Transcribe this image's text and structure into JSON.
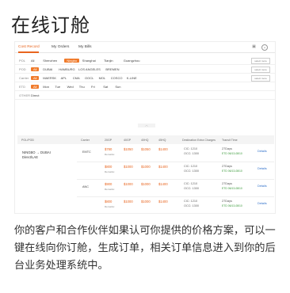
{
  "page": {
    "title": "在线订舱",
    "description": "你的客户和合作伙伴如果认可你提供的价格方案，可以一键在线向你订舱，生成订单，相关订单信息进入到你的后台业务处理系统中。"
  },
  "app": {
    "tabs": [
      "Cost Record",
      "My Orders",
      "My Bills"
    ],
    "active_tab": 0,
    "accent_color": "#e8651f",
    "header_icons": [
      "chat-icon",
      "user-icon"
    ]
  },
  "filters": [
    {
      "label": "POL",
      "options": [
        "All",
        "Shenzhen",
        "Ningbo",
        "Shanghai",
        "Tianjin",
        "Guangzhou"
      ],
      "selected": 2,
      "button": "select more"
    },
    {
      "label": "POD",
      "options": [
        "All",
        "DUBAI",
        "HAMBURG",
        "LOS ANGELES",
        "BREMEN"
      ],
      "selected": 0,
      "button": "select more"
    },
    {
      "label": "Carrier",
      "options": [
        "All",
        "MAERSK",
        "APL",
        "CMA",
        "OOCL",
        "MOL",
        "COSCO",
        "K-LINE"
      ],
      "selected": 0,
      "button": "select more"
    },
    {
      "label": "ETD",
      "options": [
        "All",
        "Mon",
        "Tue",
        "Wed",
        "Thu",
        "Fri",
        "Sat",
        "Sun"
      ],
      "selected": 0,
      "button": ""
    },
    {
      "label": "OTHER",
      "options": [
        "Direct"
      ],
      "selected": -1,
      "button": ""
    }
  ],
  "table": {
    "headers": [
      "POL/POD",
      "Carrier",
      "20GP",
      "40GP",
      "40HQ",
      "45HQ",
      "Destination Extra Charges",
      "Transit Time",
      ""
    ],
    "route": [
      "NINGBO → DUBAI",
      "Direct/LAE"
    ],
    "groups": [
      {
        "carrier": "EMTC",
        "rows": [
          {
            "p20": "$780",
            "p40": "$1050",
            "p40hq": "$1050",
            "p45": "$1400",
            "note": "Remarks:",
            "charges": [
              "CIC: 1210",
              "OCC: 1300"
            ],
            "transit": [
              "27Days",
              "ETD 06/13-08/10"
            ],
            "action": "Details"
          },
          {
            "p20": "$800",
            "p40": "$1000",
            "p40hq": "$1000",
            "p45": "$1400",
            "note": "Remarks:",
            "charges": [
              "CIC: 1210",
              "OCC: 1300"
            ],
            "transit": [
              "27Days",
              "ETD 06/13-08/10"
            ],
            "action": "Details"
          }
        ]
      },
      {
        "carrier": "ANC",
        "rows": [
          {
            "p20": "$900",
            "p40": "$1000",
            "p40hq": "$1000",
            "p45": "$1400",
            "note": "Remarks:",
            "charges": [
              "CIC: 1210",
              "OCC: 1300"
            ],
            "transit": [
              "27Days",
              "ETD 06/13-08/10"
            ],
            "action": "Details"
          },
          {
            "p20": "$800",
            "p40": "$1000",
            "p40hq": "$1000",
            "p45": "$1400",
            "note": "Remarks:",
            "charges": [
              "CIC: 1210",
              "OCC: 1300"
            ],
            "transit": [
              "27Days",
              "ETD 06/13-08/10"
            ],
            "action": "Details"
          }
        ]
      }
    ]
  }
}
